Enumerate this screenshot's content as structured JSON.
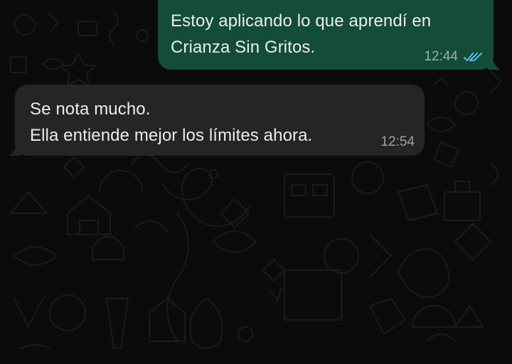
{
  "theme": {
    "background": "#0b0b0b",
    "outgoing_bubble": "#134d37",
    "incoming_bubble": "#242626",
    "text": "#e9edef",
    "read_ticks": "#53bdeb"
  },
  "messages": [
    {
      "direction": "outgoing",
      "lines": [
        "Estoy aplicando lo que aprendí en",
        "Crianza Sin Gritos."
      ],
      "time": "12:44",
      "status": "read",
      "status_icon": "double-check-icon"
    },
    {
      "direction": "incoming",
      "lines": [
        "Se nota mucho.",
        "Ella entiende mejor los límites ahora."
      ],
      "time": "12:54"
    }
  ]
}
